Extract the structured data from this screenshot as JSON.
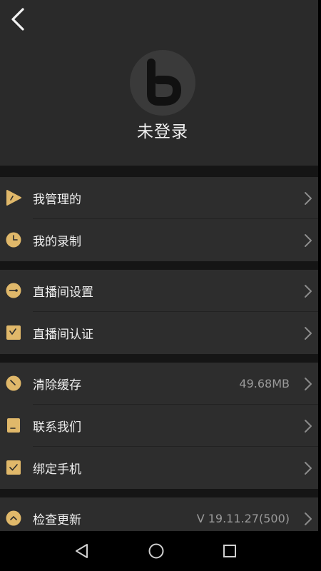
{
  "profile": {
    "username": "未登录"
  },
  "groups": [
    [
      {
        "id": "managed",
        "label": "我管理的",
        "icon": "play-icon"
      },
      {
        "id": "recording",
        "label": "我的录制",
        "icon": "clock-icon"
      }
    ],
    [
      {
        "id": "room-settings",
        "label": "直播间设置",
        "icon": "settings-icon"
      },
      {
        "id": "room-verify",
        "label": "直播间认证",
        "icon": "verify-icon"
      }
    ],
    [
      {
        "id": "clear-cache",
        "label": "清除缓存",
        "icon": "broom-icon",
        "value": "49.68MB"
      },
      {
        "id": "contact",
        "label": "联系我们",
        "icon": "contact-icon"
      },
      {
        "id": "bind-phone",
        "label": "绑定手机",
        "icon": "phone-check-icon"
      }
    ],
    [
      {
        "id": "check-update",
        "label": "检查更新",
        "icon": "update-icon",
        "value": "V 19.11.27(500)"
      }
    ]
  ],
  "colors": {
    "accent": "#e0b86a",
    "background": "#262626",
    "row": "#2d2d2d"
  }
}
